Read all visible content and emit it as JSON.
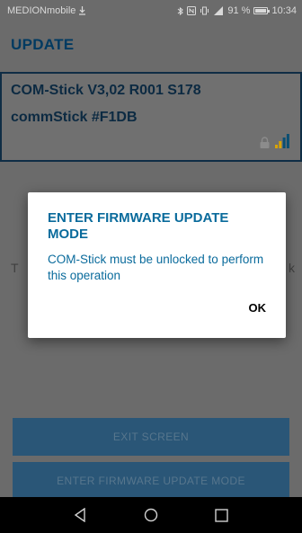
{
  "status_bar": {
    "carrier": "MEDIONmobile",
    "battery_text": "91 %",
    "battery_level": 0.91,
    "time": "10:34",
    "icons": [
      "download-icon",
      "bluetooth-icon",
      "nfc-icon",
      "vibrate-icon",
      "signal-icon",
      "battery-icon"
    ]
  },
  "app_bar": {
    "title": "UPDATE"
  },
  "device": {
    "line1": "COM-Stick V3,02 R001 S178",
    "line2": "commStick #F1DB",
    "icons": [
      "lock-icon",
      "signal-strength-icon"
    ]
  },
  "background": {
    "left_fragment": "T",
    "right_fragment": "k"
  },
  "buttons": {
    "exit": "EXIT SCREEN",
    "enter_update": "ENTER FIRMWARE UPDATE MODE"
  },
  "dialog": {
    "title": "ENTER FIRMWARE UPDATE MODE",
    "message": "COM-Stick must be unlocked to perform this operation",
    "ok": "OK"
  },
  "nav": {
    "icons": [
      "back-icon",
      "home-icon",
      "recents-icon"
    ]
  },
  "colors": {
    "title": "#003a61",
    "dialog_text": "#0a6b9c",
    "button_bg": "#2a5677",
    "signal_accent": "#d9a400"
  }
}
